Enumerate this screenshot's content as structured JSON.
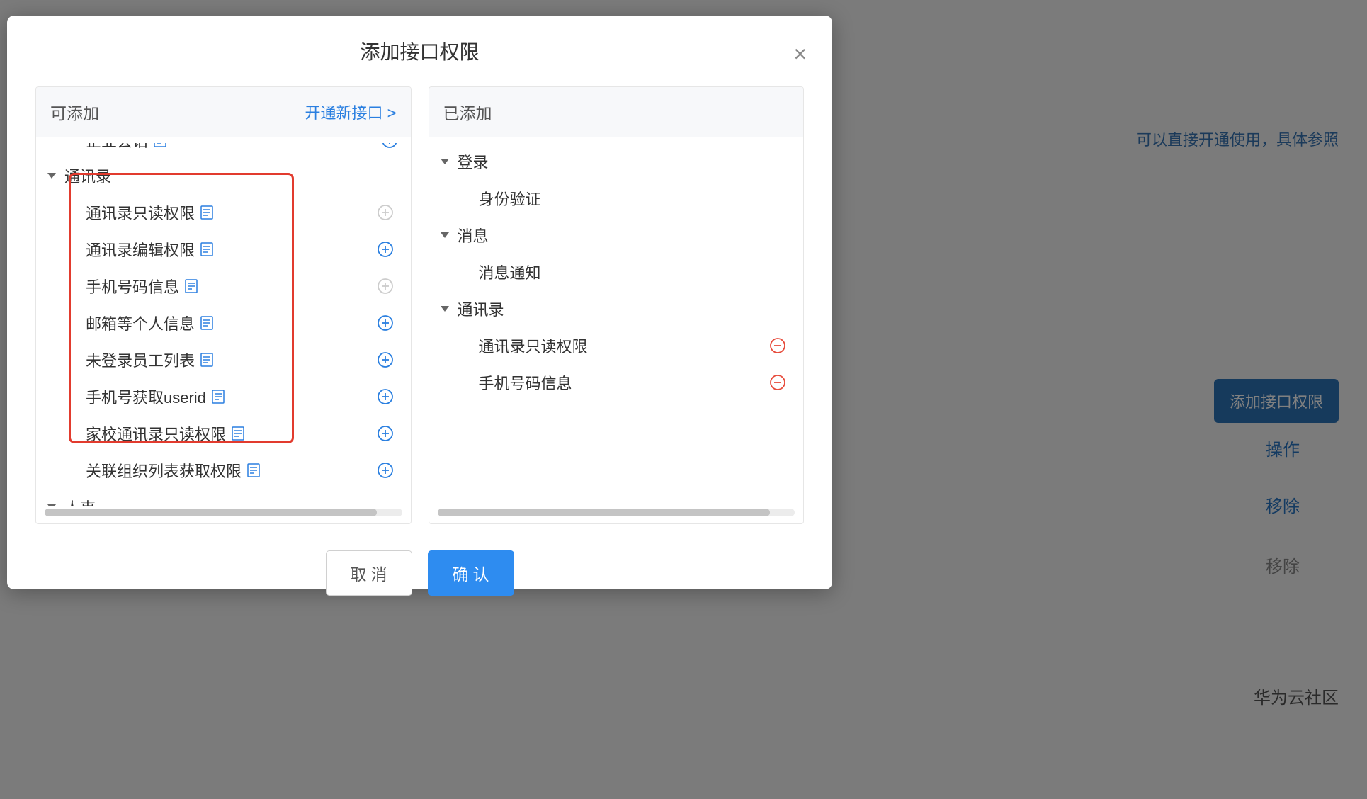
{
  "modal": {
    "title": "添加接口权限",
    "close_label": "×"
  },
  "left_panel": {
    "header": "可添加",
    "header_link": "开通新接口 >",
    "truncated_item": {
      "label": "企业会话"
    },
    "groups": [
      {
        "label": "通讯录",
        "items": [
          {
            "label": "通讯录只读权限",
            "add_enabled": false
          },
          {
            "label": "通讯录编辑权限",
            "add_enabled": true
          },
          {
            "label": "手机号码信息",
            "add_enabled": false
          },
          {
            "label": "邮箱等个人信息",
            "add_enabled": true
          },
          {
            "label": "未登录员工列表",
            "add_enabled": true
          },
          {
            "label": "手机号获取userid",
            "add_enabled": true
          },
          {
            "label": "家校通讯录只读权限",
            "add_enabled": true
          },
          {
            "label": "关联组织列表获取权限",
            "add_enabled": true
          }
        ]
      },
      {
        "label": "人事",
        "items": []
      }
    ]
  },
  "right_panel": {
    "header": "已添加",
    "groups": [
      {
        "label": "登录",
        "items": [
          {
            "label": "身份验证",
            "removable": false
          }
        ]
      },
      {
        "label": "消息",
        "items": [
          {
            "label": "消息通知",
            "removable": false
          }
        ]
      },
      {
        "label": "通讯录",
        "items": [
          {
            "label": "通讯录只读权限",
            "removable": true
          },
          {
            "label": "手机号码信息",
            "removable": true
          }
        ]
      }
    ]
  },
  "footer": {
    "cancel": "取消",
    "confirm": "确认"
  },
  "background": {
    "banner": "可以直接开通使用，具体参照",
    "add_button": "添加接口权限",
    "col_label": "操作",
    "action1": "移除",
    "action2": "移除",
    "footer": "华为云社区"
  }
}
